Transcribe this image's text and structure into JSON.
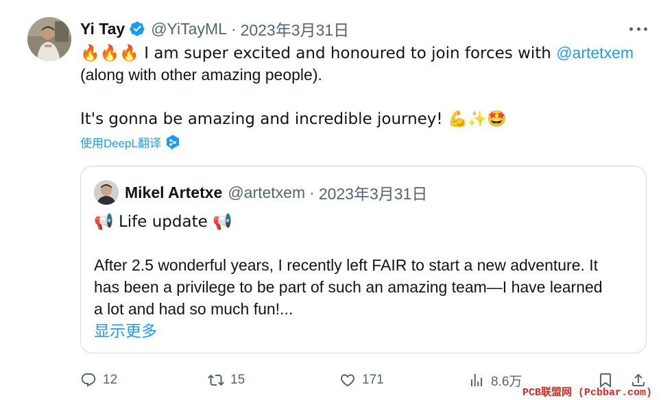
{
  "author": {
    "name": "Yi Tay",
    "handle": "@YiTayML",
    "separator": "·",
    "date": "2023年3月31日"
  },
  "tweet": {
    "line1_prefix": "🔥🔥🔥 I am super excited and honoured to join forces with ",
    "line1_mention": "@artetxem",
    "line2": "(along with other amazing people).",
    "line3": "It's gonna be amazing and incredible journey! 💪✨🤩",
    "translate_label": "使用DeepL翻译"
  },
  "quoted": {
    "name": "Mikel Artetxe",
    "handle": "@artetxem",
    "separator": "·",
    "date": "2023年3月31日",
    "line1": "📢 Life update 📢",
    "line2": "After 2.5 wonderful years, I recently left FAIR to start a new adventure. It",
    "line3": "has been a privilege to be part of such an amazing team—I have learned",
    "line4": "a lot and had so much fun!...",
    "show_more": "显示更多"
  },
  "actions": {
    "replies": "12",
    "retweets": "15",
    "likes": "171",
    "views": "8.6万"
  },
  "watermark": "PCB联盟网 (Pcbbar.com)",
  "colors": {
    "link": "#1d9bf0",
    "secondary_text": "#536471",
    "border": "#cfd9de"
  }
}
